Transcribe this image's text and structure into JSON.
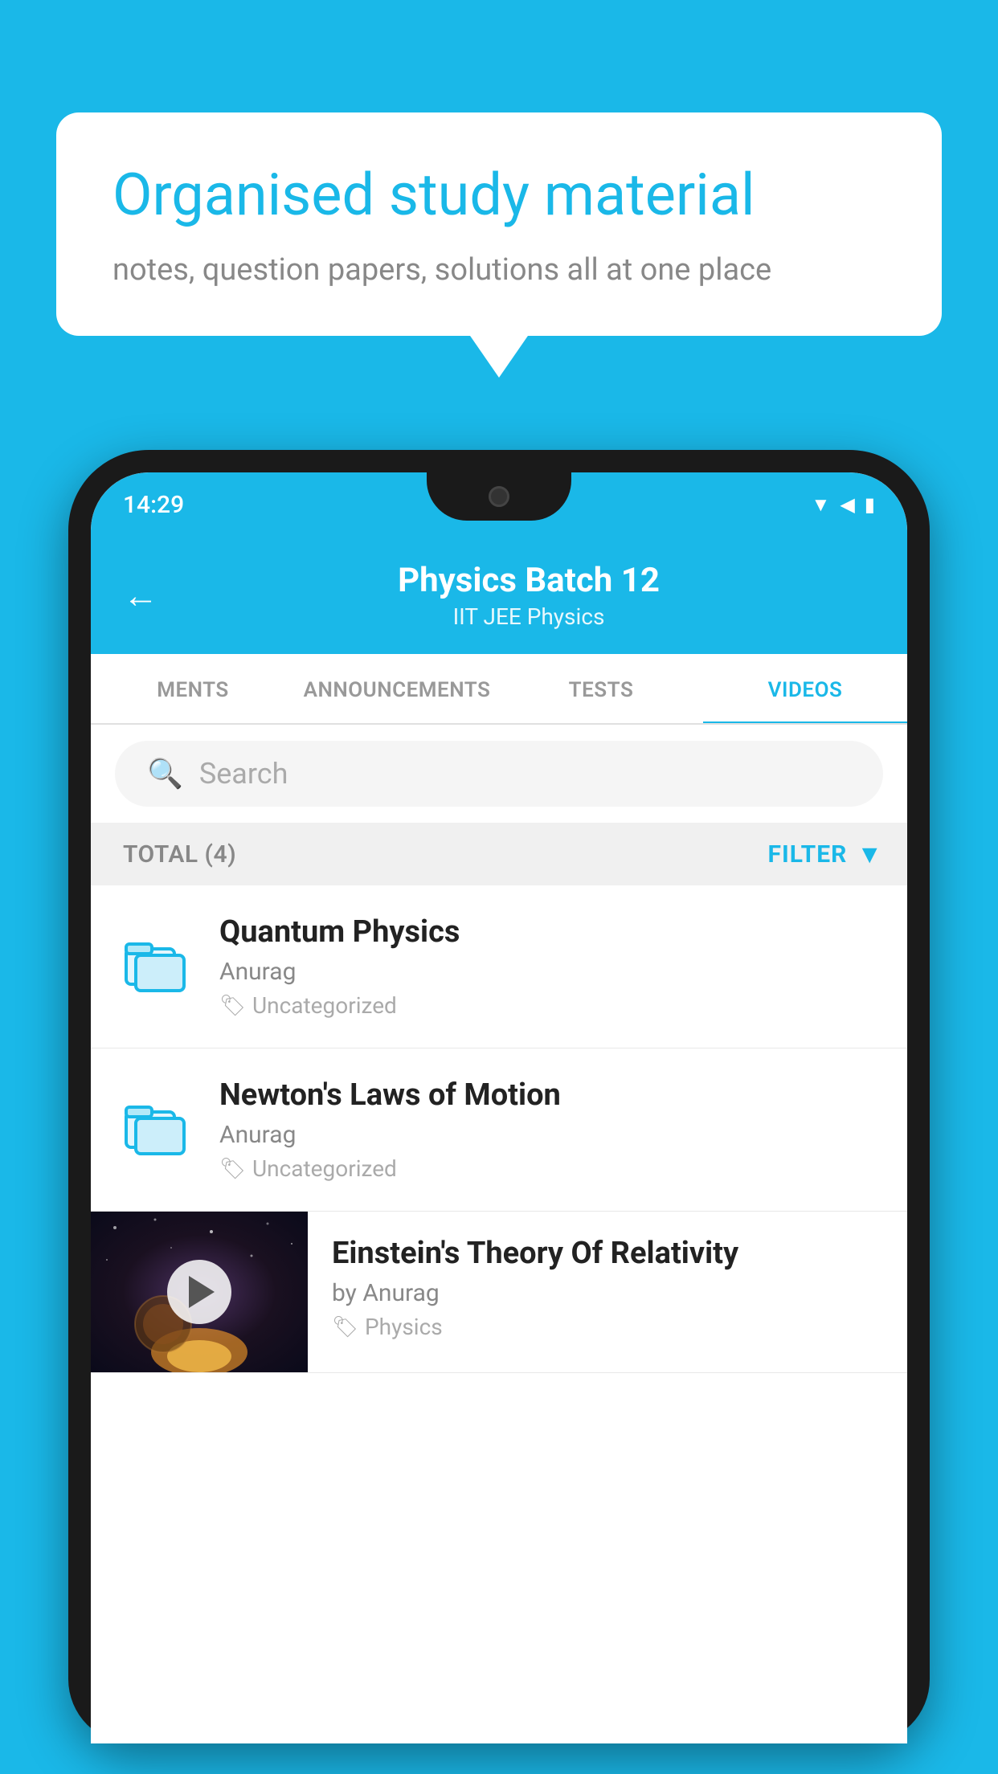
{
  "page": {
    "background_color": "#1ab8e8"
  },
  "speech_bubble": {
    "heading": "Organised study material",
    "subtext": "notes, question papers, solutions all at one place"
  },
  "phone": {
    "status_bar": {
      "time": "14:29"
    },
    "header": {
      "title": "Physics Batch 12",
      "subtitle": "IIT JEE   Physics",
      "back_label": "←"
    },
    "tabs": [
      {
        "label": "MENTS",
        "active": false
      },
      {
        "label": "ANNOUNCEMENTS",
        "active": false
      },
      {
        "label": "TESTS",
        "active": false
      },
      {
        "label": "VIDEOS",
        "active": true
      }
    ],
    "search": {
      "placeholder": "Search"
    },
    "filter_bar": {
      "total_label": "TOTAL (4)",
      "filter_label": "FILTER"
    },
    "video_items": [
      {
        "type": "folder",
        "title": "Quantum Physics",
        "author": "Anurag",
        "tag": "Uncategorized"
      },
      {
        "type": "folder",
        "title": "Newton's Laws of Motion",
        "author": "Anurag",
        "tag": "Uncategorized"
      },
      {
        "type": "thumbnail",
        "title": "Einstein's Theory Of Relativity",
        "author": "by Anurag",
        "tag": "Physics"
      }
    ]
  }
}
